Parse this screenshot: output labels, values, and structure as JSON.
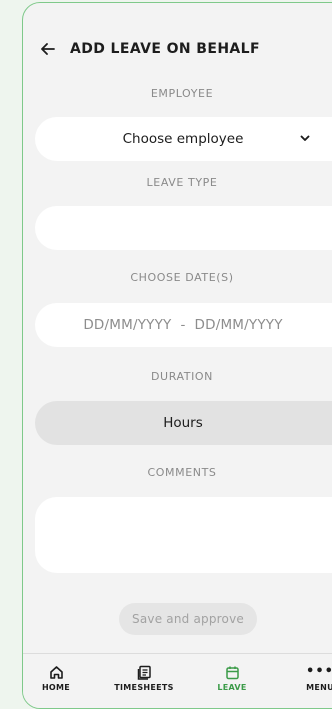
{
  "header": {
    "title": "ADD LEAVE ON BEHALF"
  },
  "form": {
    "employee_label": "EMPLOYEE",
    "employee_value": "Choose employee",
    "leave_type_label": "LEAVE TYPE",
    "leave_type_value": "",
    "dates_label": "CHOOSE DATE(S)",
    "dates_placeholder": "DD/MM/YYYY  -  DD/MM/YYYY",
    "duration_label": "DURATION",
    "duration_value": "Hours",
    "comments_label": "COMMENTS",
    "comments_value": ""
  },
  "actions": {
    "save_label": "Save and approve"
  },
  "nav": {
    "home": "HOME",
    "timesheets": "TIMESHEETS",
    "leave": "LEAVE",
    "menu": "MENU",
    "active": "LEAVE"
  },
  "colors": {
    "accent": "#5dbf6a",
    "frame_border": "#7fc98a",
    "background": "#f3f3f3"
  },
  "icons": {
    "back": "arrow-left-icon",
    "dropdown": "chevron-down-icon",
    "home": "home-icon",
    "timesheets": "timesheet-icon",
    "leave": "calendar-icon",
    "menu": "more-dots-icon"
  }
}
